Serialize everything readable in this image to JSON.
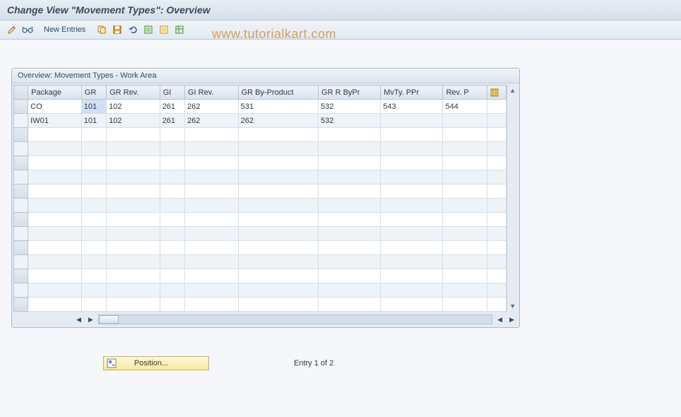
{
  "title": "Change View \"Movement Types\": Overview",
  "toolbar": {
    "new_entries": "New Entries"
  },
  "watermark": "www.tutorialkart.com",
  "panel": {
    "title": "Overview: Movement Types - Work Area"
  },
  "columns": [
    "Package",
    "GR",
    "GR Rev.",
    "GI",
    "GI Rev.",
    "GR By-Product",
    "GR R ByPr",
    "MvTy. PPr",
    "Rev. P"
  ],
  "rows": [
    {
      "package": "CO",
      "gr": "101",
      "gr_rev": "102",
      "gi": "261",
      "gi_rev": "262",
      "gr_byp": "531",
      "gr_r_byp": "532",
      "mvty_ppr": "543",
      "rev_p": "544"
    },
    {
      "package": "IW01",
      "gr": "101",
      "gr_rev": "102",
      "gi": "261",
      "gi_rev": "262",
      "gr_byp": "262",
      "gr_r_byp": "532",
      "mvty_ppr": "",
      "rev_p": ""
    }
  ],
  "footer": {
    "position_label": "Position...",
    "entry_text": "Entry 1 of 2"
  }
}
